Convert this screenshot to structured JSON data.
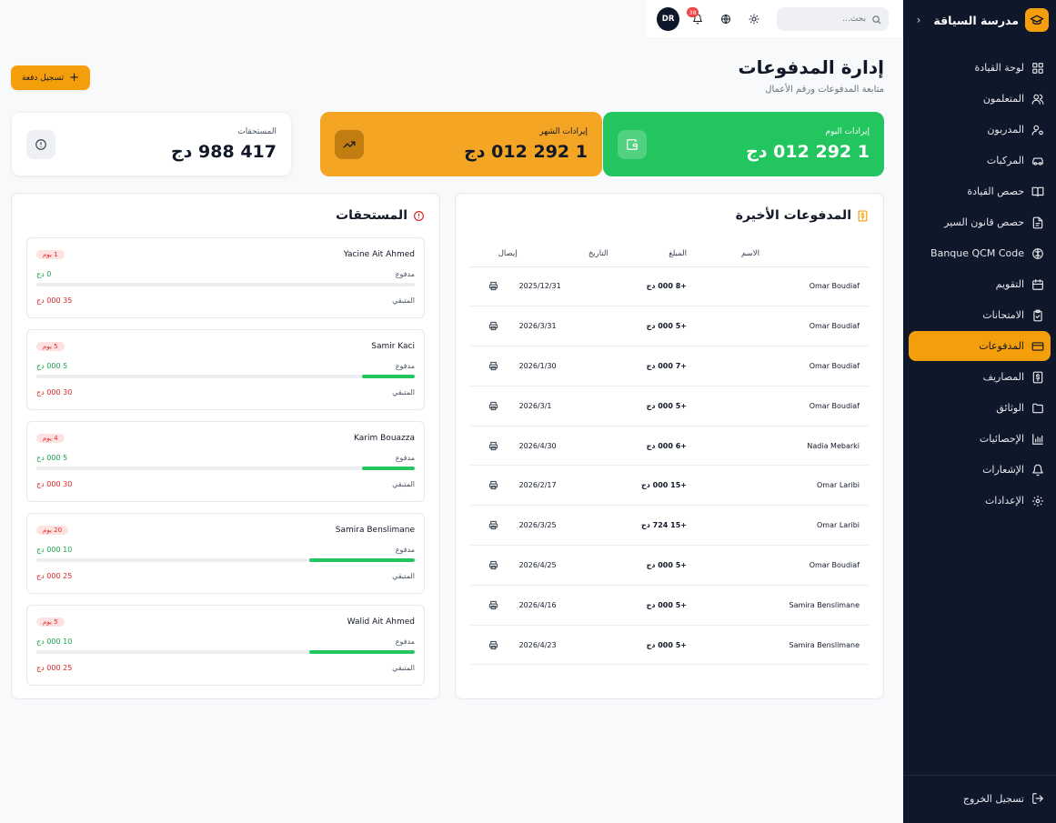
{
  "sidebar": {
    "brand": "مدرسة السياقة",
    "collapse_glyph": "‹",
    "items": [
      {
        "label": "لوحة القيادة",
        "icon": "grid-icon",
        "active": false
      },
      {
        "label": "المتعلمون",
        "icon": "users-icon",
        "active": false
      },
      {
        "label": "المدربون",
        "icon": "user-cog-icon",
        "active": false
      },
      {
        "label": "المركبات",
        "icon": "car-icon",
        "active": false
      },
      {
        "label": "حصص القيادة",
        "icon": "book-open-icon",
        "active": false
      },
      {
        "label": "حصص قانون السير",
        "icon": "file-text-icon",
        "active": false
      },
      {
        "label": "Banque QCM Code",
        "icon": "brain-icon",
        "active": false
      },
      {
        "label": "التقويم",
        "icon": "calendar-icon",
        "active": false
      },
      {
        "label": "الامتحانات",
        "icon": "clipboard-check-icon",
        "active": false
      },
      {
        "label": "المدفوعات",
        "icon": "credit-card-icon",
        "active": true
      },
      {
        "label": "المصاريف",
        "icon": "receipt-dollar-icon",
        "active": false
      },
      {
        "label": "الوثائق",
        "icon": "folder-icon",
        "active": false
      },
      {
        "label": "الإحصائيات",
        "icon": "bar-chart-icon",
        "active": false
      },
      {
        "label": "الإشعارات",
        "icon": "bell-icon",
        "active": false
      },
      {
        "label": "الإعدادات",
        "icon": "settings-icon",
        "active": false
      }
    ],
    "logout": "تسجيل الخروج"
  },
  "topbar": {
    "search_placeholder": "بحث...",
    "notification_count": "38",
    "avatar_initials": "DR"
  },
  "header": {
    "title": "إدارة المدفوعات",
    "subtitle": "متابعة المدفوعات ورقم الأعمال",
    "add_button": "تسجيل دفعة"
  },
  "stats": {
    "today": {
      "label": "إيرادات اليوم",
      "value": "1 292 012 دج"
    },
    "month": {
      "label": "إيرادات الشهر",
      "value": "1 292 012 دج"
    },
    "due": {
      "label": "المستحقات",
      "value": "417 988 دج"
    }
  },
  "payments": {
    "title": "المدفوعات الأخيرة",
    "columns": {
      "name": "الاسم",
      "amount": "المبلغ",
      "date": "التاريخ",
      "receipt": "إيصال"
    },
    "rows": [
      {
        "name": "Omar Boudiaf",
        "amount": "+8 000 دج",
        "date": "2025/12/31"
      },
      {
        "name": "Omar Boudiaf",
        "amount": "+5 000 دج",
        "date": "2026/3/31"
      },
      {
        "name": "Omar Boudiaf",
        "amount": "+7 000 دج",
        "date": "2026/1/30"
      },
      {
        "name": "Omar Boudiaf",
        "amount": "+5 000 دج",
        "date": "2026/3/1"
      },
      {
        "name": "Nadia Mebarki",
        "amount": "+6 000 دج",
        "date": "2026/4/30"
      },
      {
        "name": "Omar Laribi",
        "amount": "+15 000 دج",
        "date": "2026/2/17"
      },
      {
        "name": "Omar Laribi",
        "amount": "+15 724 دج",
        "date": "2026/3/25"
      },
      {
        "name": "Omar Boudiaf",
        "amount": "+5 000 دج",
        "date": "2026/4/25"
      },
      {
        "name": "Samira Benslimane",
        "amount": "+5 000 دج",
        "date": "2026/4/16"
      },
      {
        "name": "Samira Benslimane",
        "amount": "+5 000 دج",
        "date": "2026/4/23"
      }
    ]
  },
  "dues": {
    "title": "المستحقات",
    "paid_label": "مدفوع",
    "remaining_label": "المتبقي",
    "items": [
      {
        "name": "Yacine Ait Ahmed",
        "days": "1 يوم",
        "paid": "0 دج",
        "remaining": "35 000 دج",
        "progress": 0
      },
      {
        "name": "Samir Kaci",
        "days": "5 يوم",
        "paid": "5 000 دج",
        "remaining": "30 000 دج",
        "progress": 14
      },
      {
        "name": "Karim Bouazza",
        "days": "4 يوم",
        "paid": "5 000 دج",
        "remaining": "30 000 دج",
        "progress": 14
      },
      {
        "name": "Samira Benslimane",
        "days": "20 يوم",
        "paid": "10 000 دج",
        "remaining": "25 000 دج",
        "progress": 28
      },
      {
        "name": "Walid Ait Ahmed",
        "days": "5 يوم",
        "paid": "10 000 دج",
        "remaining": "25 000 دج",
        "progress": 28
      }
    ]
  },
  "colors": {
    "accent": "#f59e0b",
    "success": "#22c55e",
    "danger": "#dc2626",
    "sidebar_bg": "#0f172a"
  }
}
